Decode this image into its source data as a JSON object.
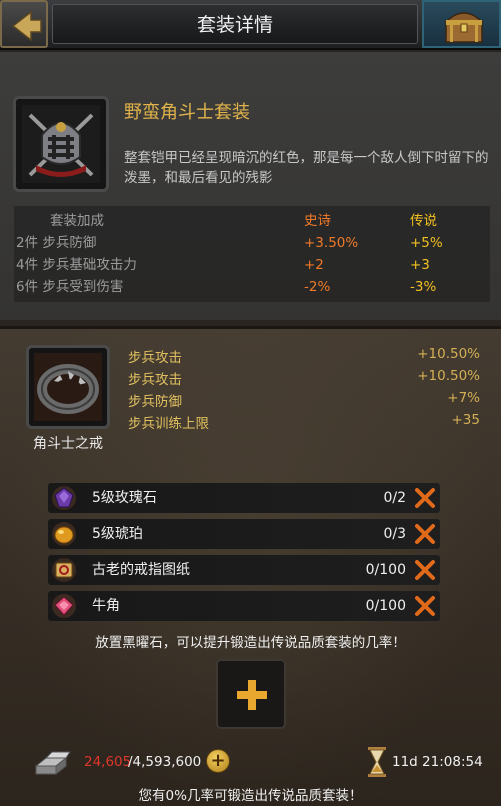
{
  "header": {
    "title": "套装详情",
    "back_icon": "back-arrow-icon",
    "chest_icon": "treasure-chest-icon"
  },
  "set": {
    "name": "野蛮角斗士套装",
    "icon": "gladiator-armor-icon",
    "description": "整套铠甲已经呈现暗沉的红色，那是每一个敌人倒下时留下的泼墨，和最后看见的残影",
    "bonus_header": {
      "label": "套装加成",
      "epic": "史诗",
      "legend": "传说"
    },
    "bonuses": [
      {
        "label": "2件 步兵防御",
        "epic": "+3.50%",
        "legend": "+5%"
      },
      {
        "label": "4件 步兵基础攻击力",
        "epic": "+2",
        "legend": "+3"
      },
      {
        "label": "6件 步兵受到伤害",
        "epic": "-2%",
        "legend": "-3%"
      }
    ]
  },
  "item": {
    "name": "角斗士之戒",
    "icon": "gladiator-ring-icon",
    "stats": [
      {
        "name": "步兵攻击",
        "value": "+10.50%"
      },
      {
        "name": "步兵攻击",
        "value": "+10.50%"
      },
      {
        "name": "步兵防御",
        "value": "+7%"
      },
      {
        "name": "步兵训练上限",
        "value": "+35"
      }
    ]
  },
  "materials": [
    {
      "name": "5级玫瑰石",
      "count": "0/2",
      "icon": "rose-stone-icon"
    },
    {
      "name": "5级琥珀",
      "count": "0/3",
      "icon": "amber-icon"
    },
    {
      "name": "古老的戒指图纸",
      "count": "0/100",
      "icon": "ring-blueprint-icon"
    },
    {
      "name": "牛角",
      "count": "0/100",
      "icon": "ox-horn-icon"
    }
  ],
  "forge": {
    "hint": "放置黑曜石，可以提升锻造出传说品质套装的几率！",
    "add_icon": "plus-icon",
    "resource_current": "24,605",
    "resource_max": "/4,593,600",
    "resource_icon": "iron-ingot-icon",
    "timer": "11d 21:08:54",
    "timer_icon": "hourglass-icon",
    "chance_text": "您有0%几率可锻造出传说品质套装！"
  },
  "colors": {
    "epic": "#f07a28",
    "legend": "#f2c020",
    "gold_text": "#e1b34a",
    "resource_warning": "#e0352a",
    "missing_x": "#e06a1a"
  }
}
